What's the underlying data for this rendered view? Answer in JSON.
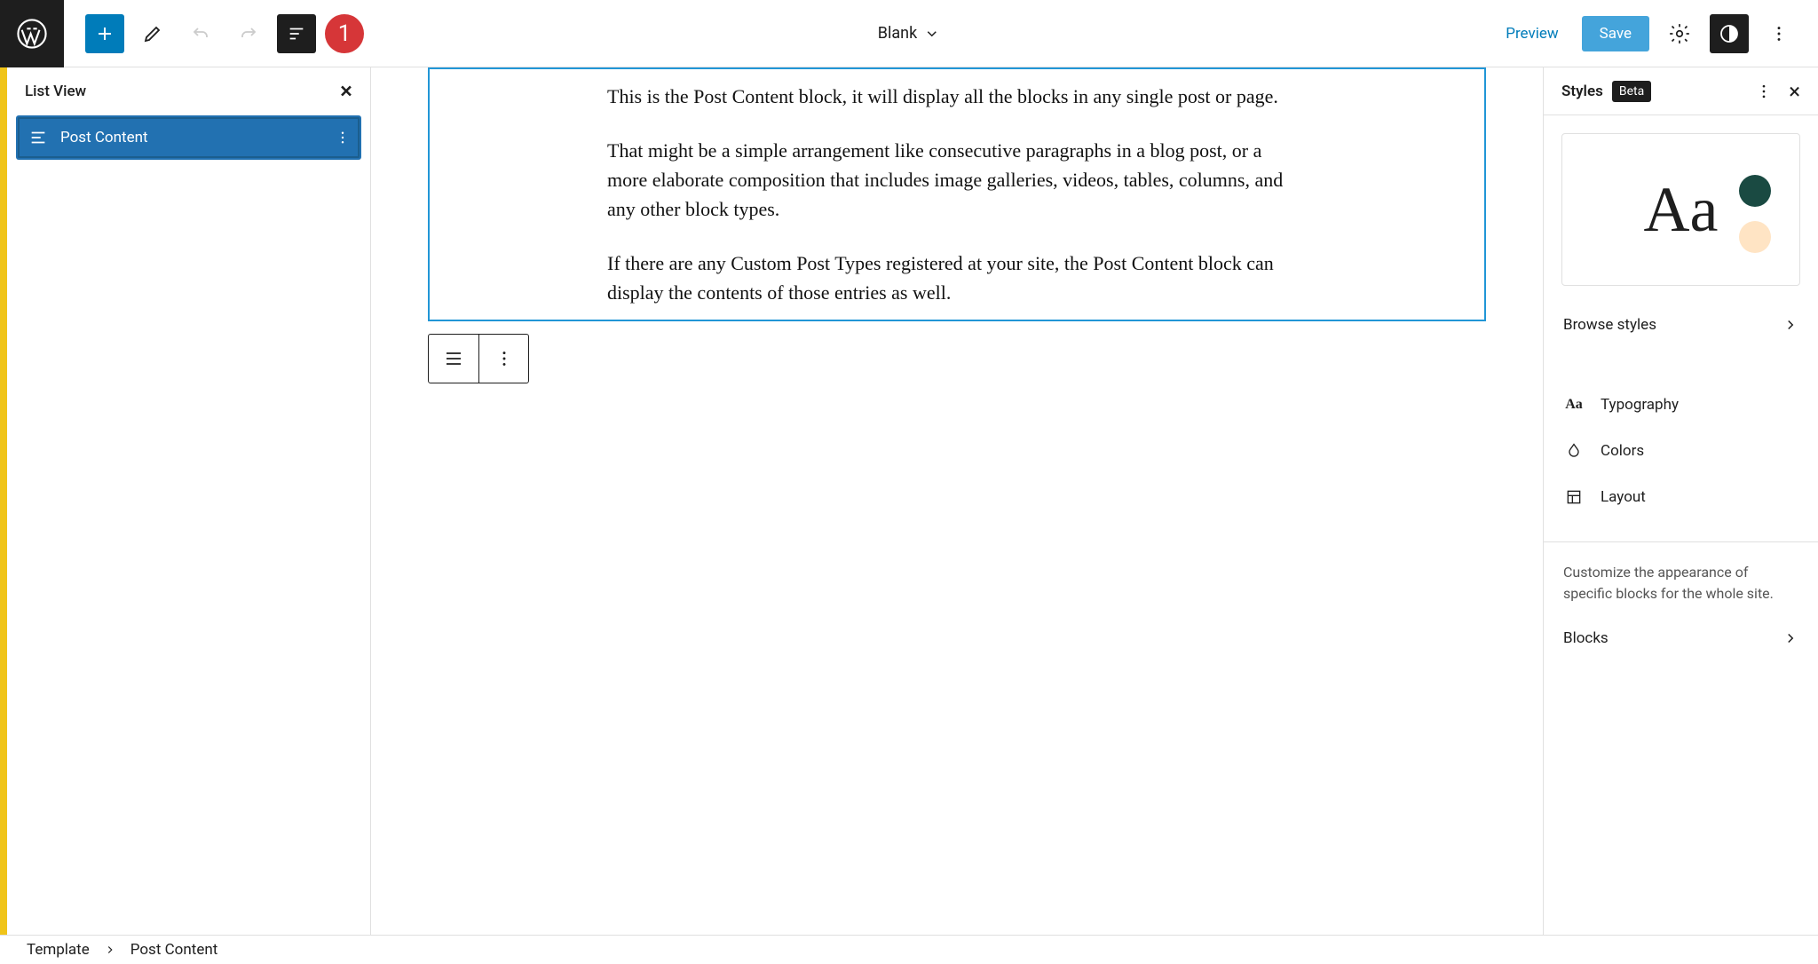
{
  "toolbar": {
    "template_name": "Blank",
    "preview": "Preview",
    "save": "Save",
    "marker": "1"
  },
  "list_view": {
    "title": "List View",
    "items": [
      {
        "label": "Post Content"
      }
    ]
  },
  "post_content": {
    "p1": "This is the Post Content block, it will display all the blocks in any single post or page.",
    "p2": "That might be a simple arrangement like consecutive paragraphs in a blog post, or a more elaborate composition that includes image galleries, videos, tables, columns, and any other block types.",
    "p3": "If there are any Custom Post Types registered at your site, the Post Content block can display the contents of those entries as well."
  },
  "styles": {
    "title": "Styles",
    "badge": "Beta",
    "preview_text": "Aa",
    "browse": "Browse styles",
    "typography": "Typography",
    "colors": "Colors",
    "layout": "Layout",
    "blocks_desc": "Customize the appearance of specific blocks for the whole site.",
    "blocks": "Blocks",
    "swatches": {
      "dark": "#1a4a42",
      "light": "#ffe4c4"
    }
  },
  "breadcrumbs": {
    "root": "Template",
    "current": "Post Content"
  }
}
